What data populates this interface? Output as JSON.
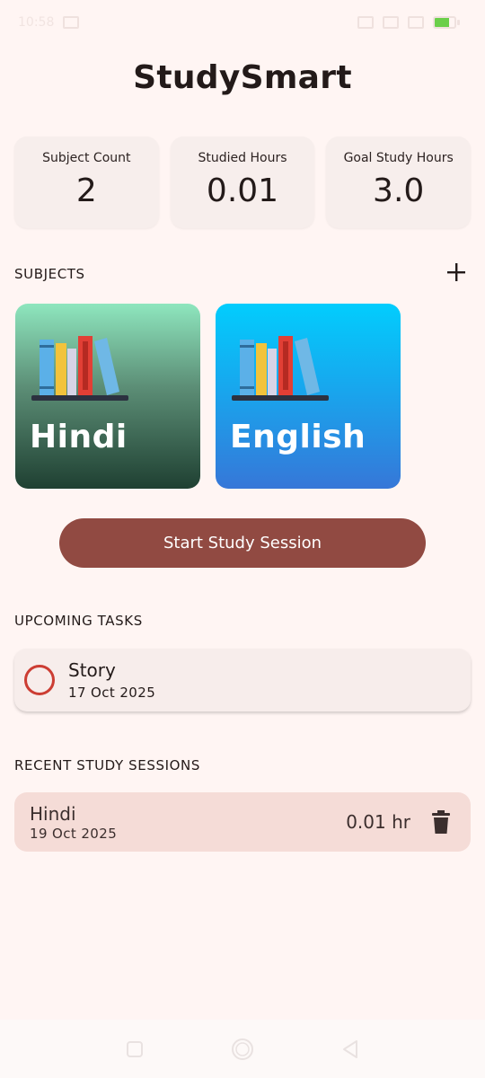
{
  "status_bar": {
    "time": "10:58",
    "battery_level": 0.71,
    "battery_text": "71"
  },
  "app": {
    "title": "StudySmart"
  },
  "stats": [
    {
      "label": "Subject Count",
      "value": "2"
    },
    {
      "label": "Studied Hours",
      "value": "0.01"
    },
    {
      "label": "Goal Study Hours",
      "value": "3.0"
    }
  ],
  "subjects_section": {
    "header": "SUBJECTS",
    "add_icon": "plus-icon",
    "items": [
      {
        "name": "Hindi",
        "gradient": [
          "#8ee6be",
          "#1f4032"
        ]
      },
      {
        "name": "English",
        "gradient": [
          "#02cdfd",
          "#3677d8"
        ]
      }
    ]
  },
  "start_session": {
    "label": "Start Study Session",
    "color": "#914a42"
  },
  "tasks_section": {
    "header": "UPCOMING TASKS",
    "items": [
      {
        "title": "Story",
        "date": "17 Oct 2025",
        "priority_color": "#cc3d33"
      }
    ]
  },
  "sessions_section": {
    "header": "RECENT STUDY SESSIONS",
    "items": [
      {
        "subject": "Hindi",
        "date": "19 Oct 2025",
        "duration": "0.01 hr",
        "delete_icon": "trash-icon"
      }
    ]
  },
  "colors": {
    "background": "#fff5f3",
    "card": "#f7eeec",
    "session_card": "#f5dcd7",
    "accent": "#914a42"
  }
}
